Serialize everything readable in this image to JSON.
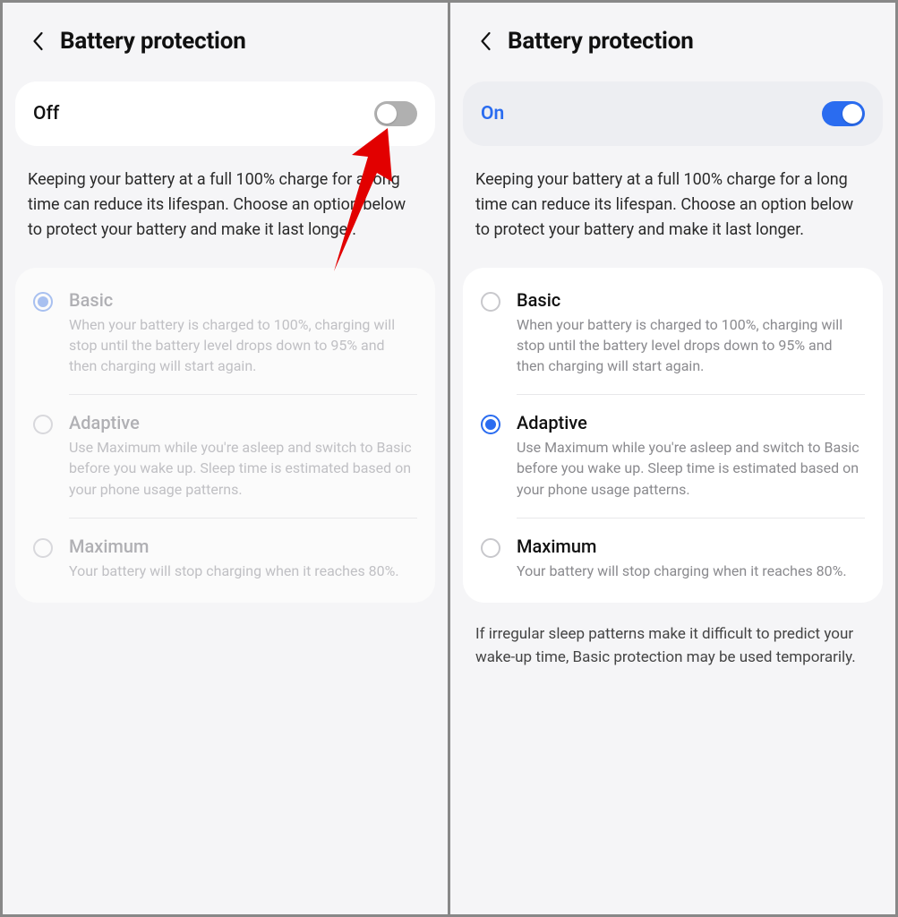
{
  "left": {
    "title": "Battery protection",
    "toggle_state": "Off",
    "description": "Keeping your battery at a full 100% charge for a long time can reduce its lifespan. Choose an option below to protect your battery and make it last longer.",
    "options": [
      {
        "title": "Basic",
        "desc": "When your battery is charged to 100%, charging will stop until the battery level drops down to 95% and then charging will start again.",
        "selected": true
      },
      {
        "title": "Adaptive",
        "desc": "Use Maximum while you're asleep and switch to Basic before you wake up. Sleep time is estimated based on your phone usage patterns.",
        "selected": false
      },
      {
        "title": "Maximum",
        "desc": "Your battery will stop charging when it reaches 80%.",
        "selected": false
      }
    ]
  },
  "right": {
    "title": "Battery protection",
    "toggle_state": "On",
    "description": "Keeping your battery at a full 100% charge for a long time can reduce its lifespan. Choose an option below to protect your battery and make it last longer.",
    "options": [
      {
        "title": "Basic",
        "desc": "When your battery is charged to 100%, charging will stop until the battery level drops down to 95% and then charging will start again.",
        "selected": false
      },
      {
        "title": "Adaptive",
        "desc": "Use Maximum while you're asleep and switch to Basic before you wake up. Sleep time is estimated based on your phone usage patterns.",
        "selected": true
      },
      {
        "title": "Maximum",
        "desc": "Your battery will stop charging when it reaches 80%.",
        "selected": false
      }
    ],
    "footnote": "If irregular sleep patterns make it difficult to predict your wake-up time, Basic protection may be used temporarily."
  }
}
